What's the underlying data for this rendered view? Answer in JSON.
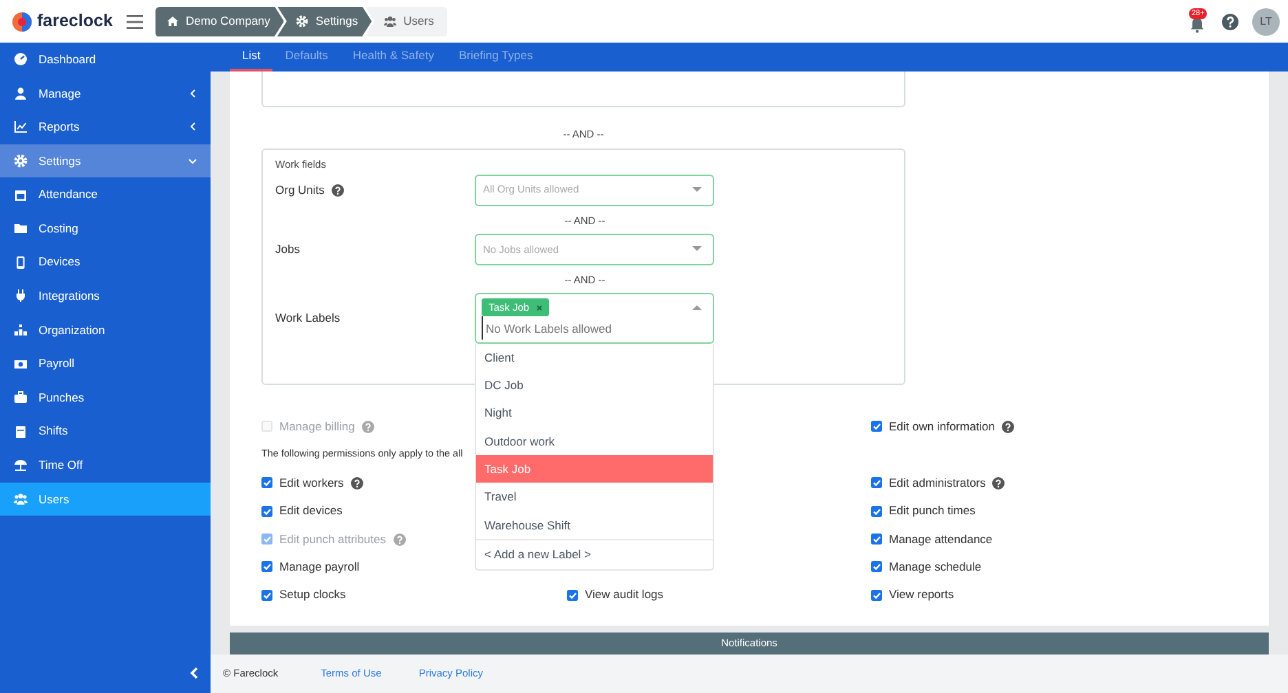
{
  "brand": {
    "name": "fareclock"
  },
  "breadcrumbs": [
    {
      "label": "Demo Company",
      "selected": false
    },
    {
      "label": "Settings",
      "selected": false
    },
    {
      "label": "Users",
      "selected": true
    }
  ],
  "header": {
    "notification_count": "28+",
    "avatar": "LT"
  },
  "sidebar": {
    "items": [
      {
        "label": "Dashboard",
        "kind": "link",
        "selected": false
      },
      {
        "label": "Manage",
        "kind": "group",
        "expanded": false,
        "selected": false
      },
      {
        "label": "Reports",
        "kind": "group",
        "expanded": false,
        "selected": false
      },
      {
        "label": "Settings",
        "kind": "group",
        "expanded": true,
        "selected": false,
        "children": [
          {
            "label": "Attendance",
            "kind": "link",
            "selected": false
          },
          {
            "label": "Costing",
            "kind": "link",
            "selected": false
          },
          {
            "label": "Devices",
            "kind": "link",
            "selected": false
          },
          {
            "label": "Integrations",
            "kind": "link",
            "selected": false
          },
          {
            "label": "Organization",
            "kind": "link",
            "selected": false
          },
          {
            "label": "Payroll",
            "kind": "link",
            "selected": false
          },
          {
            "label": "Punches",
            "kind": "link",
            "selected": false
          },
          {
            "label": "Shifts",
            "kind": "link",
            "selected": false
          },
          {
            "label": "Time Off",
            "kind": "link",
            "selected": false
          },
          {
            "label": "Users",
            "kind": "link",
            "selected": true
          }
        ]
      }
    ]
  },
  "tabs": [
    {
      "label": "List",
      "selected": true
    },
    {
      "label": "Defaults",
      "selected": false
    },
    {
      "label": "Health & Safety",
      "selected": false
    },
    {
      "label": "Briefing Types",
      "selected": false
    }
  ],
  "separator_top": "-- AND --",
  "work_fields": {
    "title": "Work fields",
    "fields": [
      {
        "label": "Org Units",
        "help": true,
        "placeholder": "All Org Units allowed",
        "expanded": false
      },
      {
        "separator": "-- AND --"
      },
      {
        "label": "Jobs",
        "help": false,
        "placeholder": "No Jobs allowed",
        "expanded": false
      },
      {
        "separator": "-- AND --"
      },
      {
        "label": "Work Labels",
        "help": false,
        "tags": [
          "Task Job"
        ],
        "placeholder": "No Work Labels allowed",
        "expanded": true,
        "options": [
          {
            "label": "Client",
            "selected": false
          },
          {
            "label": "DC Job",
            "selected": false
          },
          {
            "label": "Night",
            "selected": false
          },
          {
            "label": "Outdoor work",
            "selected": false
          },
          {
            "label": "Task Job",
            "selected": true
          },
          {
            "label": "Travel",
            "selected": false
          },
          {
            "label": "Warehouse Shift",
            "selected": false
          }
        ],
        "add_option": "< Add a new Label >"
      }
    ]
  },
  "permissions": [
    {
      "kind": "checkboxes",
      "column_1": {
        "label": "Manage billing",
        "checked": false,
        "disabled": true,
        "help": true
      },
      "column_3": {
        "label": "Edit own information",
        "checked": true,
        "disabled": false,
        "help": true
      }
    },
    {
      "kind": "note",
      "text": "The following permissions only apply to the all"
    },
    {
      "kind": "checkboxes",
      "column_1": {
        "label": "Edit workers",
        "checked": true,
        "disabled": false,
        "help": true
      },
      "column_3": {
        "label": "Edit administrators",
        "checked": true,
        "disabled": false,
        "help": true
      }
    },
    {
      "kind": "checkboxes",
      "column_1": {
        "label": "Edit devices",
        "checked": true,
        "disabled": false,
        "help": false
      },
      "column_3": {
        "label": "Edit punch times",
        "checked": true,
        "disabled": false,
        "help": false
      }
    },
    {
      "kind": "checkboxes",
      "column_1": {
        "label": "Edit punch attributes",
        "checked": true,
        "disabled": true,
        "help": true
      },
      "column_3": {
        "label": "Manage attendance",
        "checked": true,
        "disabled": false,
        "help": false
      }
    },
    {
      "kind": "checkboxes",
      "column_1": {
        "label": "Manage payroll",
        "checked": true,
        "disabled": false,
        "help": false
      },
      "column_3": {
        "label": "Manage schedule",
        "checked": true,
        "disabled": false,
        "help": false
      }
    },
    {
      "kind": "checkboxes",
      "column_1": {
        "label": "Setup clocks",
        "checked": true,
        "disabled": false,
        "help": false
      },
      "column_2": {
        "label": "View audit logs",
        "checked": true,
        "disabled": false,
        "help": false
      },
      "column_3": {
        "label": "View reports",
        "checked": true,
        "disabled": false,
        "help": false
      }
    }
  ],
  "notifications_bar": "Notifications",
  "footer": {
    "copyright": "© Fareclock",
    "links": [
      "Terms of Use",
      "Privacy Policy"
    ]
  }
}
